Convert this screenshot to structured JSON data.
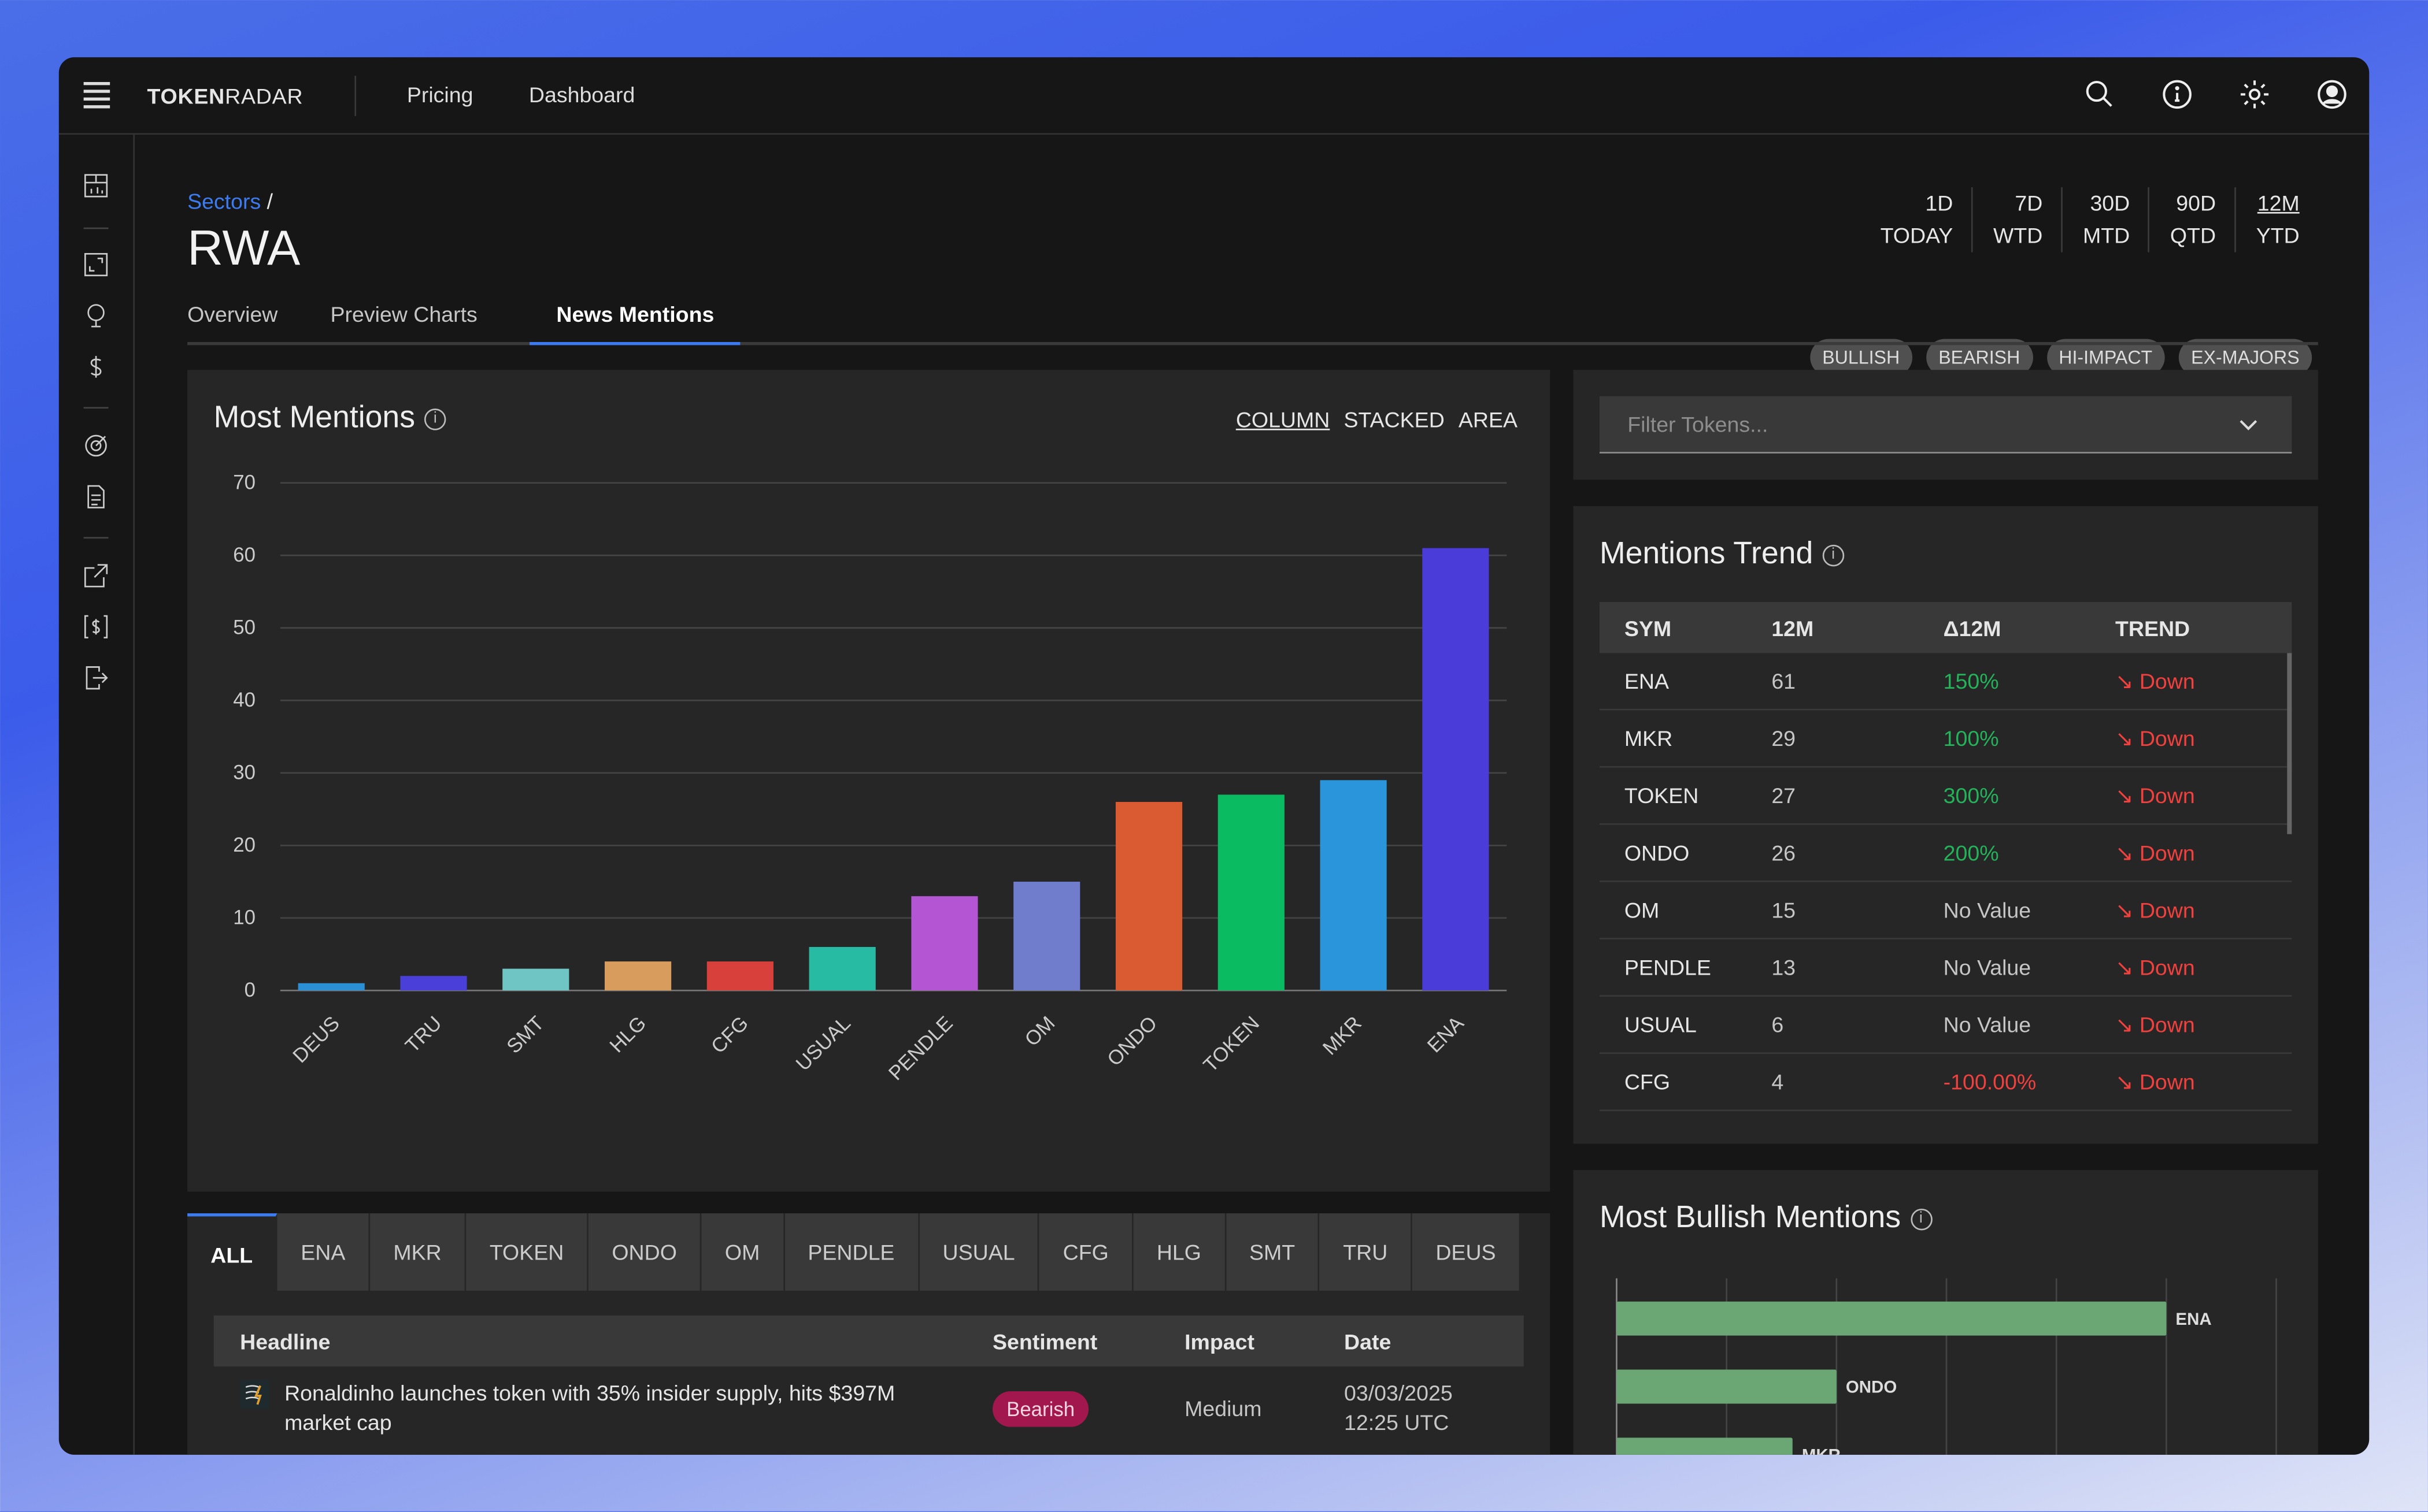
{
  "app": {
    "brand_bold": "TOKEN",
    "brand_light": "RADAR",
    "nav": [
      "Pricing",
      "Dashboard"
    ]
  },
  "header_icons": [
    "search-icon",
    "info-icon",
    "sun-icon",
    "user-icon"
  ],
  "breadcrumb": {
    "link": "Sectors",
    "sep": "/"
  },
  "page_title": "RWA",
  "tabs": [
    "Overview",
    "Preview Charts",
    "News Mentions"
  ],
  "active_tab": "News Mentions",
  "periods": [
    {
      "top": "1D",
      "bottom": "TODAY"
    },
    {
      "top": "7D",
      "bottom": "WTD"
    },
    {
      "top": "30D",
      "bottom": "MTD"
    },
    {
      "top": "90D",
      "bottom": "QTD"
    },
    {
      "top": "12M",
      "bottom": "YTD"
    }
  ],
  "selected_period": "12M",
  "filters": [
    "BULLISH",
    "BEARISH",
    "HI-IMPACT",
    "EX-MAJORS"
  ],
  "most_mentions": {
    "title": "Most Mentions",
    "chart_types": [
      "COLUMN",
      "STACKED",
      "AREA"
    ],
    "selected_type": "COLUMN"
  },
  "chart_data": [
    {
      "type": "bar",
      "title": "Most Mentions",
      "categories": [
        "DEUS",
        "TRU",
        "SMT",
        "HLG",
        "CFG",
        "USUAL",
        "PENDLE",
        "OM",
        "ONDO",
        "TOKEN",
        "MKR",
        "ENA"
      ],
      "values": [
        1,
        2,
        3,
        4,
        4,
        6,
        13,
        15,
        26,
        27,
        29,
        61
      ],
      "colors": [
        "#2b8fd6",
        "#4b3fd9",
        "#6fc4c4",
        "#d89c5c",
        "#d8403b",
        "#27bba3",
        "#b455d3",
        "#6f7dcc",
        "#da5b31",
        "#0abb62",
        "#2b95dc",
        "#4a3cd9"
      ],
      "yticks": [
        0,
        10,
        20,
        30,
        40,
        50,
        60,
        70
      ],
      "ylim": [
        0,
        70
      ],
      "grid": true
    },
    {
      "type": "bar",
      "orientation": "horizontal",
      "title": "Most Bullish Mentions",
      "categories": [
        "ENA",
        "ONDO",
        "MKR"
      ],
      "values": [
        5,
        2,
        1.6
      ],
      "xlim": [
        0,
        6
      ],
      "color": "#6aa774",
      "grid": true
    }
  ],
  "token_tabs": [
    "ALL",
    "ENA",
    "MKR",
    "TOKEN",
    "ONDO",
    "OM",
    "PENDLE",
    "USUAL",
    "CFG",
    "HLG",
    "SMT",
    "TRU",
    "DEUS"
  ],
  "news": {
    "headers": [
      "Headline",
      "Sentiment",
      "Impact",
      "Date"
    ],
    "rows": [
      {
        "headline": "Ronaldinho launches token with 35% insider supply, hits $397M market cap",
        "sentiment": "Bearish",
        "impact": "Medium",
        "date": "03/03/2025",
        "time": "12:25 UTC"
      }
    ]
  },
  "filter_tokens": {
    "placeholder": "Filter Tokens..."
  },
  "trend": {
    "title": "Mentions Trend",
    "headers": [
      "SYM",
      "12M",
      "Δ12M",
      "TREND"
    ],
    "rows": [
      {
        "sym": "ENA",
        "m": "61",
        "d": "150%",
        "dc": "pos",
        "t": "Down"
      },
      {
        "sym": "MKR",
        "m": "29",
        "d": "100%",
        "dc": "pos",
        "t": "Down"
      },
      {
        "sym": "TOKEN",
        "m": "27",
        "d": "300%",
        "dc": "pos",
        "t": "Down"
      },
      {
        "sym": "ONDO",
        "m": "26",
        "d": "200%",
        "dc": "pos",
        "t": "Down"
      },
      {
        "sym": "OM",
        "m": "15",
        "d": "No Value",
        "dc": "",
        "t": "Down"
      },
      {
        "sym": "PENDLE",
        "m": "13",
        "d": "No Value",
        "dc": "",
        "t": "Down"
      },
      {
        "sym": "USUAL",
        "m": "6",
        "d": "No Value",
        "dc": "",
        "t": "Down"
      },
      {
        "sym": "CFG",
        "m": "4",
        "d": "-100.00%",
        "dc": "neg",
        "t": "Down"
      }
    ]
  },
  "bullish": {
    "title": "Most Bullish Mentions"
  }
}
